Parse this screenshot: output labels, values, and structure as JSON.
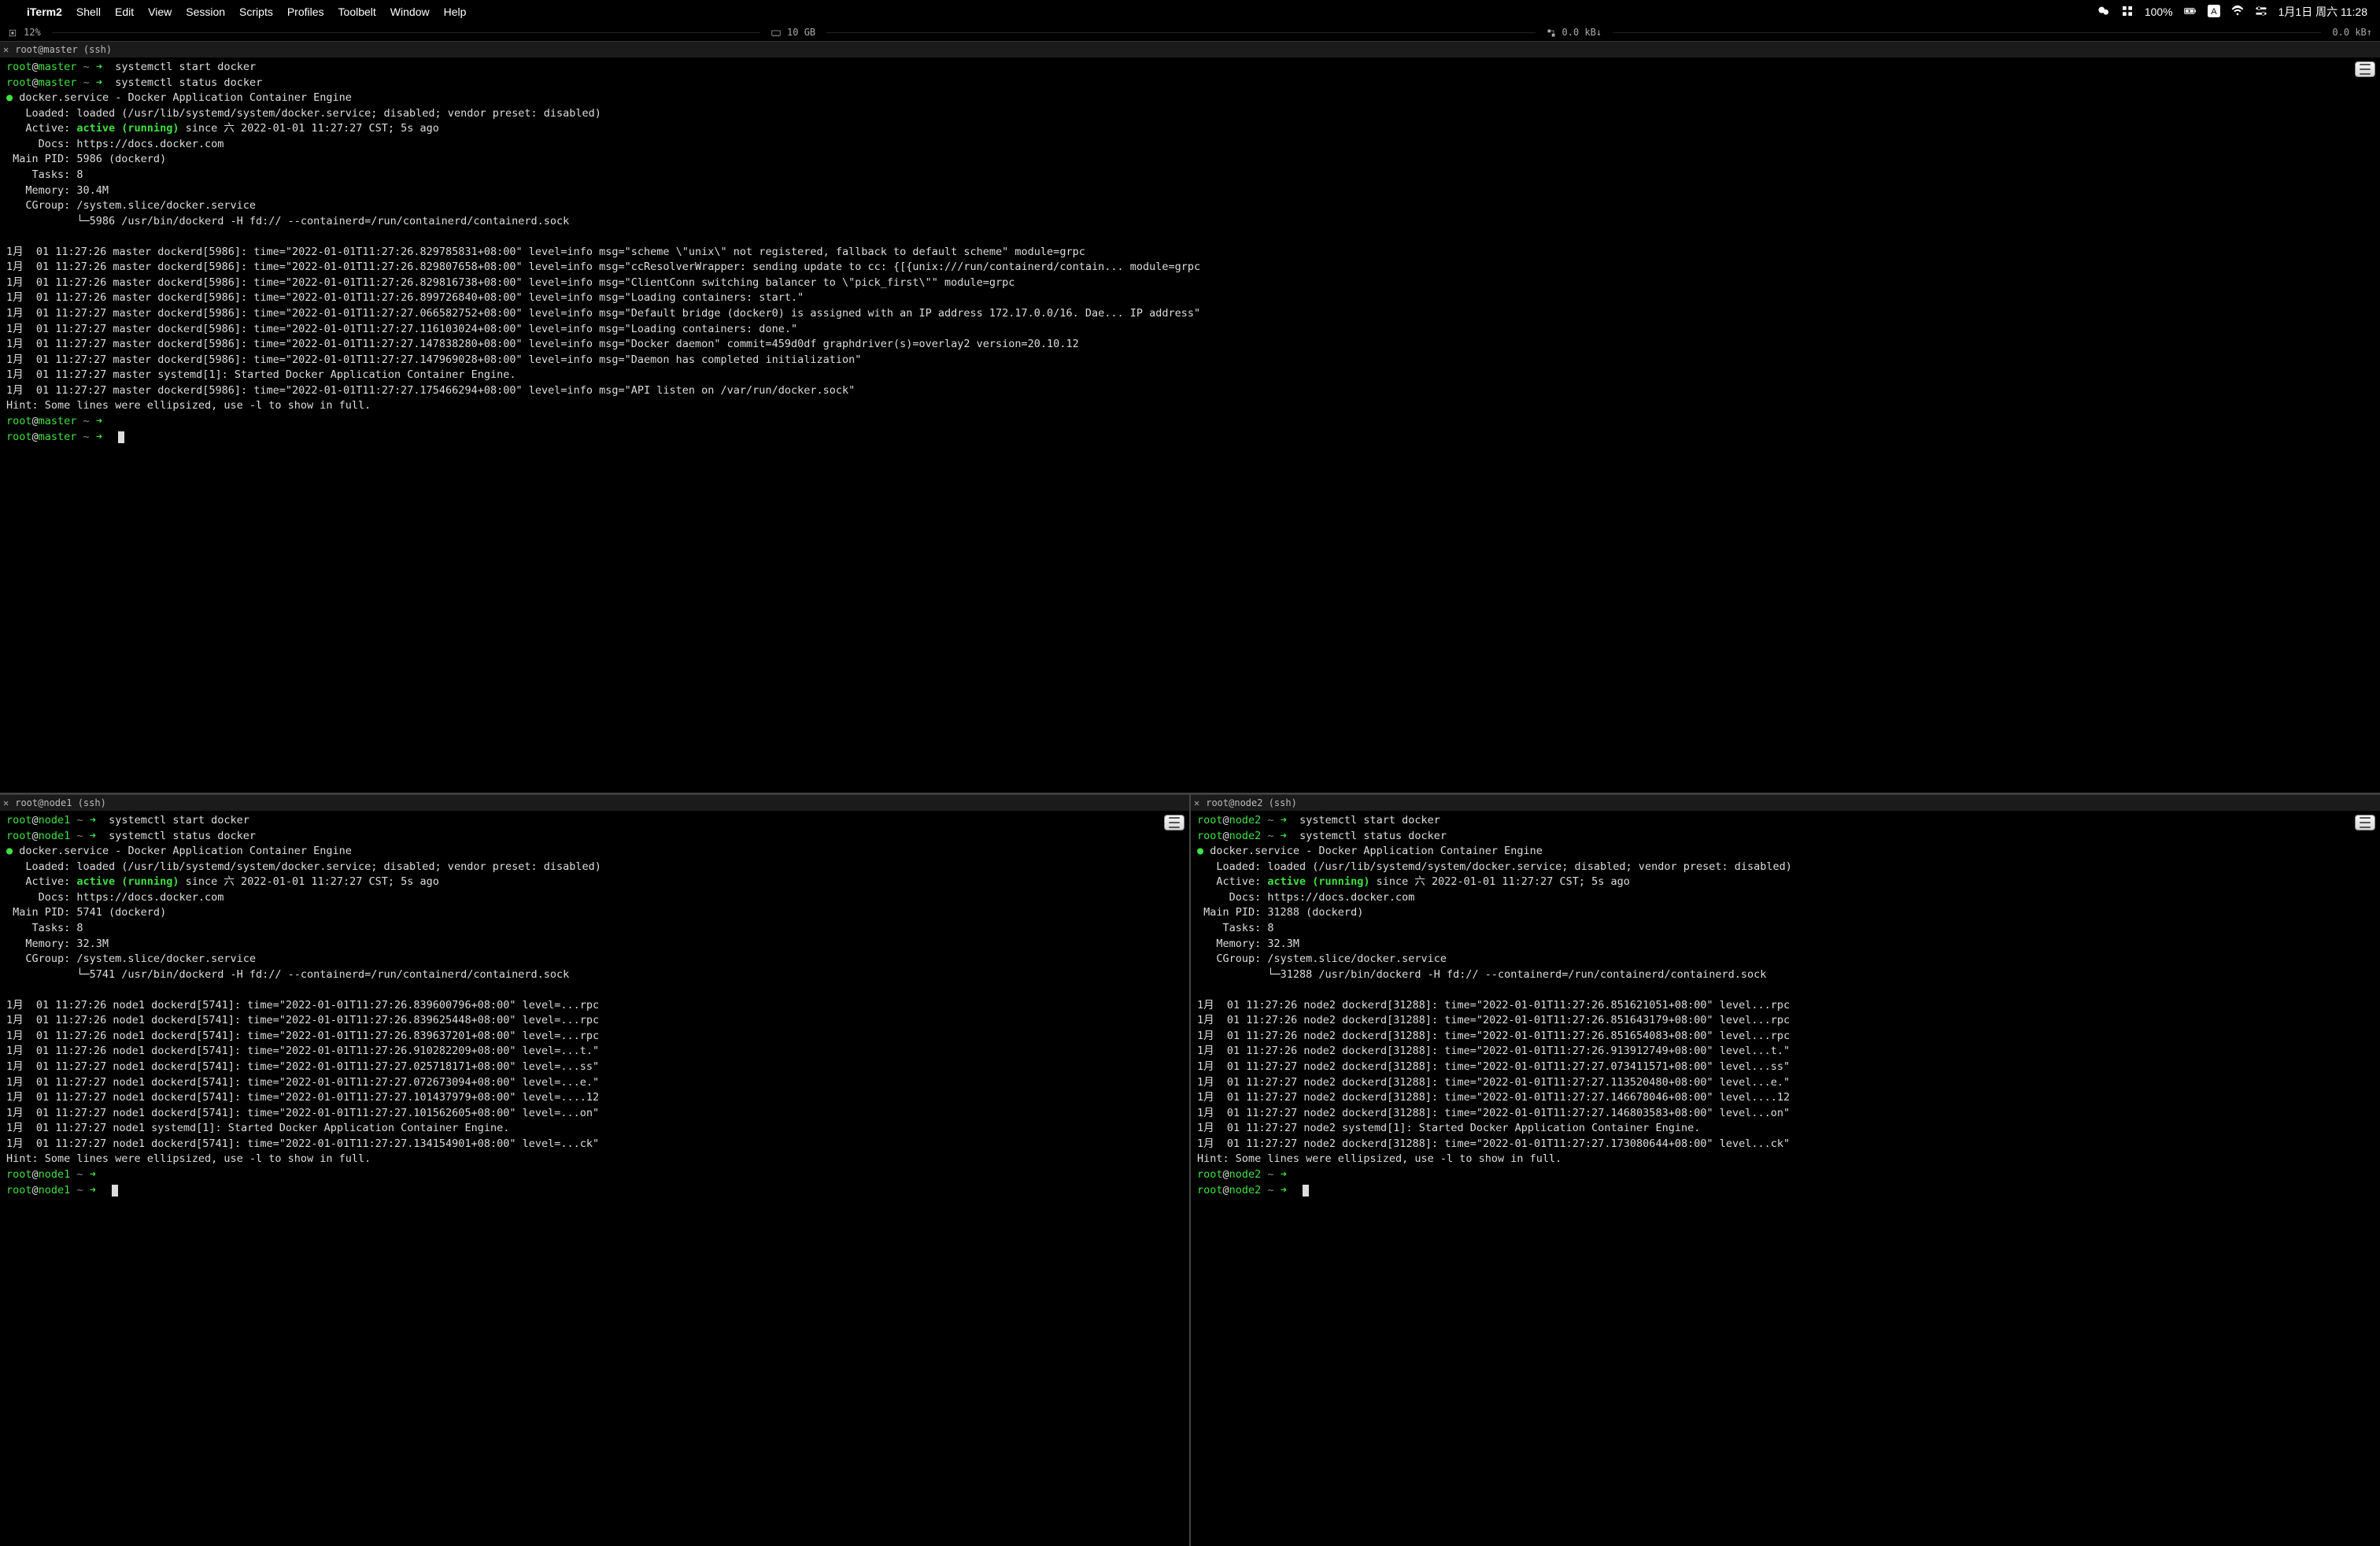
{
  "menubar": {
    "app": "iTerm2",
    "items": [
      "Shell",
      "Edit",
      "View",
      "Session",
      "Scripts",
      "Profiles",
      "Toolbelt",
      "Window",
      "Help"
    ],
    "battery": "100%",
    "datetime": "1月1日 周六 11:28"
  },
  "stats": {
    "cpu_pct": "12%",
    "ram": "10 GB",
    "net_down": "0.0 kB↓",
    "net_up": "0.0 kB↑"
  },
  "panes": {
    "top": {
      "tab_title": "root@master (ssh)",
      "prompt_user": "root",
      "prompt_host": "master",
      "cmds": [
        "systemctl start docker",
        "systemctl status docker"
      ],
      "status": {
        "header": "docker.service - Docker Application Container Engine",
        "loaded": "   Loaded: loaded (/usr/lib/systemd/system/docker.service; disabled; vendor preset: disabled)",
        "active_pre": "   Active: ",
        "active_state": "active (running)",
        "active_post": " since 六 2022-01-01 11:27:27 CST; 5s ago",
        "docs": "     Docs: https://docs.docker.com",
        "mainpid": " Main PID: 5986 (dockerd)",
        "tasks": "    Tasks: 8",
        "memory": "   Memory: 30.4M",
        "cgroup": "   CGroup: /system.slice/docker.service",
        "cgroup2": "           └─5986 /usr/bin/dockerd -H fd:// --containerd=/run/containerd/containerd.sock"
      },
      "log_lines": [
        "1月  01 11:27:26 master dockerd[5986]: time=\"2022-01-01T11:27:26.829785831+08:00\" level=info msg=\"scheme \\\"unix\\\" not registered, fallback to default scheme\" module=grpc",
        "1月  01 11:27:26 master dockerd[5986]: time=\"2022-01-01T11:27:26.829807658+08:00\" level=info msg=\"ccResolverWrapper: sending update to cc: {[{unix:///run/containerd/contain... module=grpc",
        "1月  01 11:27:26 master dockerd[5986]: time=\"2022-01-01T11:27:26.829816738+08:00\" level=info msg=\"ClientConn switching balancer to \\\"pick_first\\\"\" module=grpc",
        "1月  01 11:27:26 master dockerd[5986]: time=\"2022-01-01T11:27:26.899726840+08:00\" level=info msg=\"Loading containers: start.\"",
        "1月  01 11:27:27 master dockerd[5986]: time=\"2022-01-01T11:27:27.066582752+08:00\" level=info msg=\"Default bridge (docker0) is assigned with an IP address 172.17.0.0/16. Dae... IP address\"",
        "1月  01 11:27:27 master dockerd[5986]: time=\"2022-01-01T11:27:27.116103024+08:00\" level=info msg=\"Loading containers: done.\"",
        "1月  01 11:27:27 master dockerd[5986]: time=\"2022-01-01T11:27:27.147838280+08:00\" level=info msg=\"Docker daemon\" commit=459d0df graphdriver(s)=overlay2 version=20.10.12",
        "1月  01 11:27:27 master dockerd[5986]: time=\"2022-01-01T11:27:27.147969028+08:00\" level=info msg=\"Daemon has completed initialization\"",
        "1月  01 11:27:27 master systemd[1]: Started Docker Application Container Engine.",
        "1月  01 11:27:27 master dockerd[5986]: time=\"2022-01-01T11:27:27.175466294+08:00\" level=info msg=\"API listen on /var/run/docker.sock\""
      ],
      "hint": "Hint: Some lines were ellipsized, use -l to show in full."
    },
    "bl": {
      "tab_title": "root@node1 (ssh)",
      "prompt_user": "root",
      "prompt_host": "node1",
      "cmds": [
        "systemctl start docker",
        "systemctl status docker"
      ],
      "status": {
        "header": "docker.service - Docker Application Container Engine",
        "loaded": "   Loaded: loaded (/usr/lib/systemd/system/docker.service; disabled; vendor preset: disabled)",
        "active_pre": "   Active: ",
        "active_state": "active (running)",
        "active_post": " since 六 2022-01-01 11:27:27 CST; 5s ago",
        "docs": "     Docs: https://docs.docker.com",
        "mainpid": " Main PID: 5741 (dockerd)",
        "tasks": "    Tasks: 8",
        "memory": "   Memory: 32.3M",
        "cgroup": "   CGroup: /system.slice/docker.service",
        "cgroup2": "           └─5741 /usr/bin/dockerd -H fd:// --containerd=/run/containerd/containerd.sock"
      },
      "log_lines": [
        "1月  01 11:27:26 node1 dockerd[5741]: time=\"2022-01-01T11:27:26.839600796+08:00\" level=...rpc",
        "1月  01 11:27:26 node1 dockerd[5741]: time=\"2022-01-01T11:27:26.839625448+08:00\" level=...rpc",
        "1月  01 11:27:26 node1 dockerd[5741]: time=\"2022-01-01T11:27:26.839637201+08:00\" level=...rpc",
        "1月  01 11:27:26 node1 dockerd[5741]: time=\"2022-01-01T11:27:26.910282209+08:00\" level=...t.\"",
        "1月  01 11:27:27 node1 dockerd[5741]: time=\"2022-01-01T11:27:27.025718171+08:00\" level=...ss\"",
        "1月  01 11:27:27 node1 dockerd[5741]: time=\"2022-01-01T11:27:27.072673094+08:00\" level=...e.\"",
        "1月  01 11:27:27 node1 dockerd[5741]: time=\"2022-01-01T11:27:27.101437979+08:00\" level=....12",
        "1月  01 11:27:27 node1 dockerd[5741]: time=\"2022-01-01T11:27:27.101562605+08:00\" level=...on\"",
        "1月  01 11:27:27 node1 systemd[1]: Started Docker Application Container Engine.",
        "1月  01 11:27:27 node1 dockerd[5741]: time=\"2022-01-01T11:27:27.134154901+08:00\" level=...ck\""
      ],
      "hint": "Hint: Some lines were ellipsized, use -l to show in full."
    },
    "br": {
      "tab_title": "root@node2 (ssh)",
      "prompt_user": "root",
      "prompt_host": "node2",
      "cmds": [
        "systemctl start docker",
        "systemctl status docker"
      ],
      "status": {
        "header": "docker.service - Docker Application Container Engine",
        "loaded": "   Loaded: loaded (/usr/lib/systemd/system/docker.service; disabled; vendor preset: disabled)",
        "active_pre": "   Active: ",
        "active_state": "active (running)",
        "active_post": " since 六 2022-01-01 11:27:27 CST; 5s ago",
        "docs": "     Docs: https://docs.docker.com",
        "mainpid": " Main PID: 31288 (dockerd)",
        "tasks": "    Tasks: 8",
        "memory": "   Memory: 32.3M",
        "cgroup": "   CGroup: /system.slice/docker.service",
        "cgroup2": "           └─31288 /usr/bin/dockerd -H fd:// --containerd=/run/containerd/containerd.sock"
      },
      "log_lines": [
        "1月  01 11:27:26 node2 dockerd[31288]: time=\"2022-01-01T11:27:26.851621051+08:00\" level...rpc",
        "1月  01 11:27:26 node2 dockerd[31288]: time=\"2022-01-01T11:27:26.851643179+08:00\" level...rpc",
        "1月  01 11:27:26 node2 dockerd[31288]: time=\"2022-01-01T11:27:26.851654083+08:00\" level...rpc",
        "1月  01 11:27:26 node2 dockerd[31288]: time=\"2022-01-01T11:27:26.913912749+08:00\" level...t.\"",
        "1月  01 11:27:27 node2 dockerd[31288]: time=\"2022-01-01T11:27:27.073411571+08:00\" level...ss\"",
        "1月  01 11:27:27 node2 dockerd[31288]: time=\"2022-01-01T11:27:27.113520480+08:00\" level...e.\"",
        "1月  01 11:27:27 node2 dockerd[31288]: time=\"2022-01-01T11:27:27.146678046+08:00\" level....12",
        "1月  01 11:27:27 node2 dockerd[31288]: time=\"2022-01-01T11:27:27.146803583+08:00\" level...on\"",
        "1月  01 11:27:27 node2 systemd[1]: Started Docker Application Container Engine.",
        "1月  01 11:27:27 node2 dockerd[31288]: time=\"2022-01-01T11:27:27.173080644+08:00\" level...ck\""
      ],
      "hint": "Hint: Some lines were ellipsized, use -l to show in full."
    }
  }
}
